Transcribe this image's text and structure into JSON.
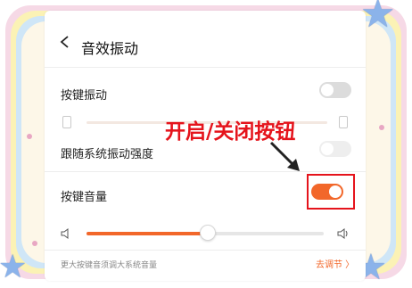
{
  "header": {
    "title": "音效振动"
  },
  "settings": {
    "key_vibration": {
      "label": "按键振动",
      "enabled": false
    },
    "follow_system": {
      "label": "跟随系统振动强度",
      "enabled": false,
      "disabled": true
    },
    "key_sound": {
      "label": "按键音量",
      "enabled": true
    }
  },
  "volume": {
    "level": 0.51
  },
  "hint": {
    "text": "更大按键音须调大系统音量",
    "link_label": "去调节 〉"
  },
  "annotation": {
    "text": "开启/关闭按钮"
  },
  "colors": {
    "accent": "#f2672a",
    "annotation_red": "#e5141c"
  },
  "icons": [
    "back-icon",
    "vibration-icon",
    "volume-low-icon",
    "volume-high-icon",
    "star-icon"
  ]
}
